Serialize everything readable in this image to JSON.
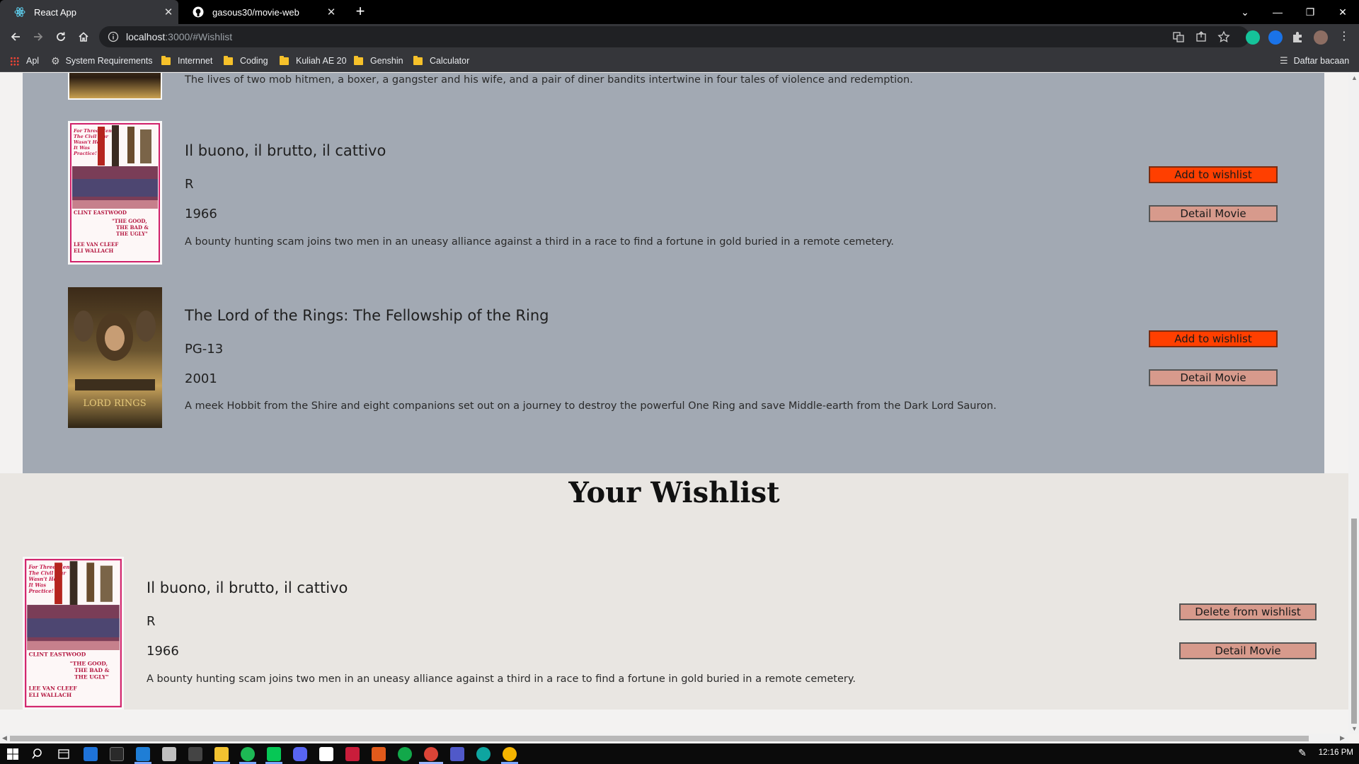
{
  "browser": {
    "tabs": [
      {
        "title": "React App",
        "active": true
      },
      {
        "title": "gasous30/movie-web",
        "active": false
      }
    ],
    "url_host": "localhost",
    "url_path": ":3000/#Wishlist",
    "bookmarks": [
      "Apl",
      "System Requirements",
      "Internnet",
      "Coding",
      "Kuliah AE 20",
      "Genshin",
      "Calculator"
    ],
    "reading_list": "Daftar bacaan"
  },
  "movies_top_desc": "The lives of two mob hitmen, a boxer, a gangster and his wife, and a pair of diner bandits intertwine in four tales of violence and redemption.",
  "movies": [
    {
      "title": "Il buono, il brutto, il cattivo",
      "rating": "R",
      "year": "1966",
      "description": "A bounty hunting scam joins two men in an uneasy alliance against a third in a race to find a fortune in gold buried in a remote cemetery.",
      "add_label": "Add to wishlist",
      "detail_label": "Detail Movie"
    },
    {
      "title": "The Lord of the Rings: The Fellowship of the Ring",
      "rating": "PG-13",
      "year": "2001",
      "description": "A meek Hobbit from the Shire and eight companions set out on a journey to destroy the powerful One Ring and save Middle-earth from the Dark Lord Sauron.",
      "add_label": "Add to wishlist",
      "detail_label": "Detail Movie"
    }
  ],
  "wishlist": {
    "heading": "Your Wishlist",
    "items": [
      {
        "title": "Il buono, il brutto, il cattivo",
        "rating": "R",
        "year": "1966",
        "description": "A bounty hunting scam joins two men in an uneasy alliance against a third in a race to find a fortune in gold buried in a remote cemetery.",
        "delete_label": "Delete from wishlist",
        "detail_label": "Detail Movie"
      }
    ]
  },
  "posters": {
    "gbu_text": [
      "For Three Men",
      "The Civil War",
      "Wasn't Hell.",
      "It Was",
      "Practice!",
      "CLINT EASTWOOD",
      "\"THE GOOD,",
      "THE BAD &",
      "THE UGLY\"",
      "LEE VAN CLEEF",
      "ELI WALLACH"
    ],
    "lotr_text": "LORD RINGS"
  },
  "taskbar": {
    "time": "12:16 PM"
  },
  "colors": {
    "movies_panel": "#a2a9b3",
    "wishlist_bg": "#e9e6e2",
    "add_button": "#ff3f00",
    "detail_button": "#d79a8c"
  }
}
